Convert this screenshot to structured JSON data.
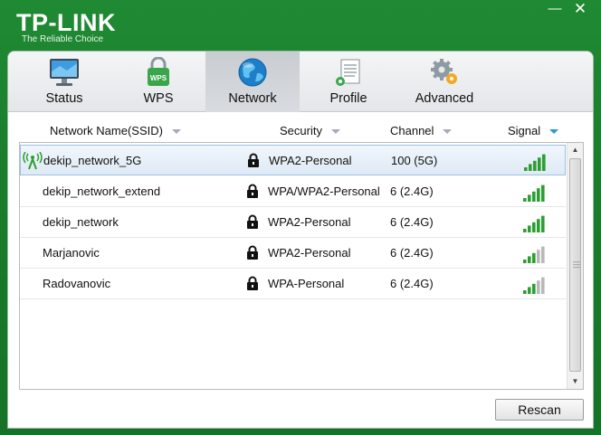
{
  "app": {
    "brand": "TP-LINK",
    "tagline": "The Reliable Choice",
    "min_glyph": "—",
    "close_glyph": "✕"
  },
  "tabs": [
    {
      "label": "Status",
      "icon": "monitor-icon"
    },
    {
      "label": "WPS",
      "icon": "wps-lock-icon"
    },
    {
      "label": "Network",
      "icon": "globe-icon",
      "active": true
    },
    {
      "label": "Profile",
      "icon": "profile-document-icon"
    },
    {
      "label": "Advanced",
      "icon": "gears-icon"
    }
  ],
  "columns": {
    "ssid": "Network Name(SSID)",
    "security": "Security",
    "channel": "Channel",
    "signal": "Signal"
  },
  "networks": [
    {
      "ssid": "dekip_network_5G",
      "security": "WPA2-Personal",
      "channel": "100 (5G)",
      "signal_bars": 5,
      "connected": true
    },
    {
      "ssid": "dekip_network_extend",
      "security": "WPA/WPA2-Personal",
      "channel": "6 (2.4G)",
      "signal_bars": 5
    },
    {
      "ssid": "dekip_network",
      "security": "WPA2-Personal",
      "channel": "6 (2.4G)",
      "signal_bars": 5
    },
    {
      "ssid": "Marjanovic",
      "security": "WPA2-Personal",
      "channel": "6 (2.4G)",
      "signal_bars": 3
    },
    {
      "ssid": "Radovanovic",
      "security": "WPA-Personal",
      "channel": "6 (2.4G)",
      "signal_bars": 3
    }
  ],
  "buttons": {
    "rescan": "Rescan"
  },
  "colors": {
    "brand_green": "#1f8a33",
    "signal_green": "#2e9e34",
    "signal_gray": "#b8b8b8",
    "sort_arrow_blue": "#2a9ad6"
  }
}
